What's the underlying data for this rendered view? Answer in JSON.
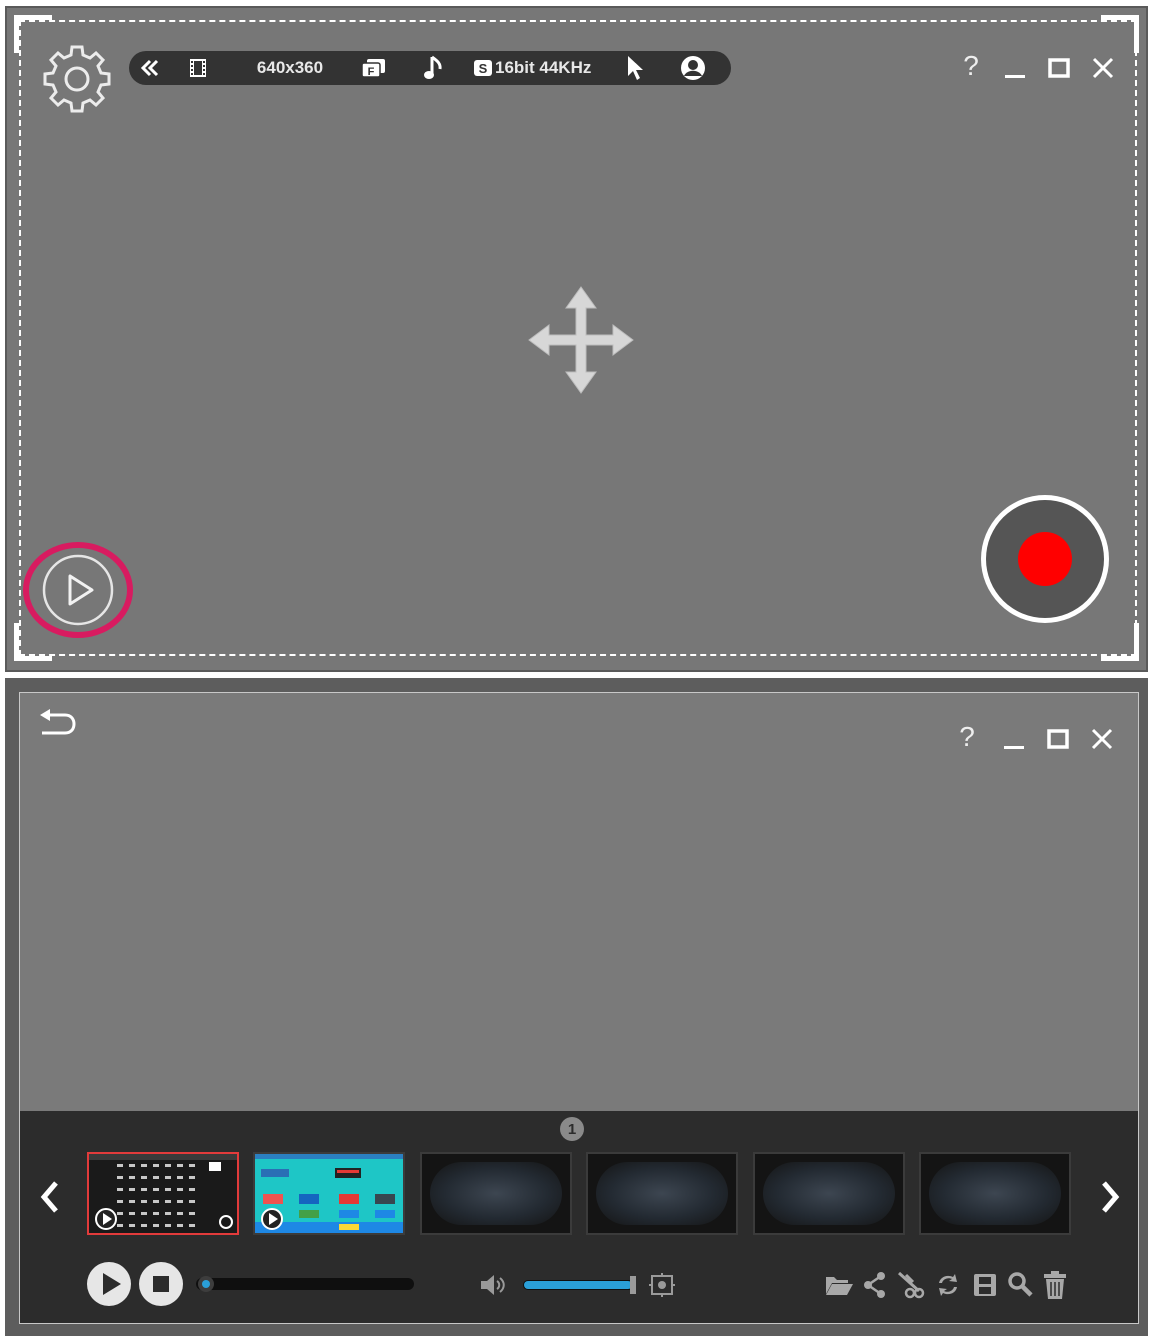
{
  "recorder": {
    "toolbar": {
      "resolution": "640x360",
      "audio_format": "16bit 44KHz"
    },
    "window_controls": {
      "help": "?"
    }
  },
  "player": {
    "window_controls": {
      "help": "?"
    },
    "page_indicator": "1",
    "thumbnails": [
      {
        "state": "recorded",
        "selected": true
      },
      {
        "state": "recorded",
        "selected": false
      },
      {
        "state": "empty",
        "selected": false
      },
      {
        "state": "empty",
        "selected": false
      },
      {
        "state": "empty",
        "selected": false
      },
      {
        "state": "empty",
        "selected": false
      }
    ],
    "seek_progress": 0,
    "volume_level": 1.0
  },
  "colors": {
    "panel_gray": "#777777",
    "toolbar_dark": "#333333",
    "record_red": "#ff0000",
    "highlight_pink": "#d81b60",
    "slider_blue": "#2a9fd8",
    "selected_thumb_border": "#e23b3b"
  },
  "icons": [
    "settings-gear-icon",
    "collapse-chevrons-icon",
    "film-icon",
    "format-icon",
    "music-note-icon",
    "audio-source-icon",
    "cursor-icon",
    "webcam-icon",
    "move-arrows-icon",
    "play-circle-icon",
    "record-icon",
    "back-arrow-icon",
    "help-icon",
    "minimize-icon",
    "maximize-icon",
    "close-icon",
    "volume-icon",
    "fullscreen-icon",
    "folder-icon",
    "share-icon",
    "cut-icon",
    "convert-icon",
    "save-icon",
    "search-icon",
    "trash-icon"
  ]
}
